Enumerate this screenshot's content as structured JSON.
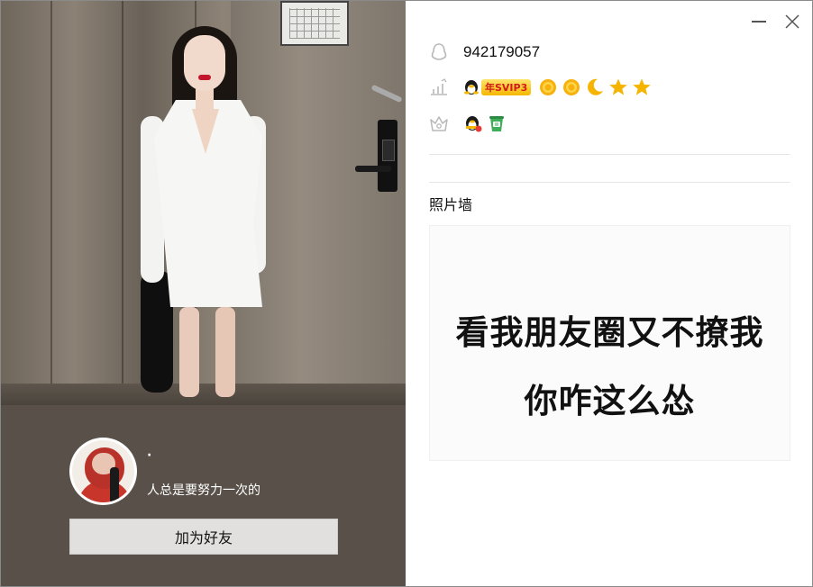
{
  "window": {
    "minimize_icon": "minimize-icon",
    "close_icon": "close-icon"
  },
  "left": {
    "nickname": "·",
    "signature": "人总是要努力一次的",
    "add_friend_label": "加为好友"
  },
  "right": {
    "qq_number": "942179057",
    "vip_label": "年SVIP3",
    "level_icons": [
      "sun-icon",
      "sun-icon",
      "moon-icon",
      "star-icon",
      "star-icon"
    ],
    "service_icons": [
      "qq-penguin-badge-icon",
      "green-bucket-badge-icon"
    ],
    "photo_wall_title": "照片墙",
    "photo_wall_text_line1": "看我朋友圈又不撩我",
    "photo_wall_text_line2": "你咋这么怂"
  },
  "colors": {
    "left_panel_bg": "#595149",
    "button_bg": "#e1e0df",
    "vip_gold": "#f4b700",
    "vip_red": "#d21c1c",
    "icon_gray": "#b8b8b8"
  }
}
